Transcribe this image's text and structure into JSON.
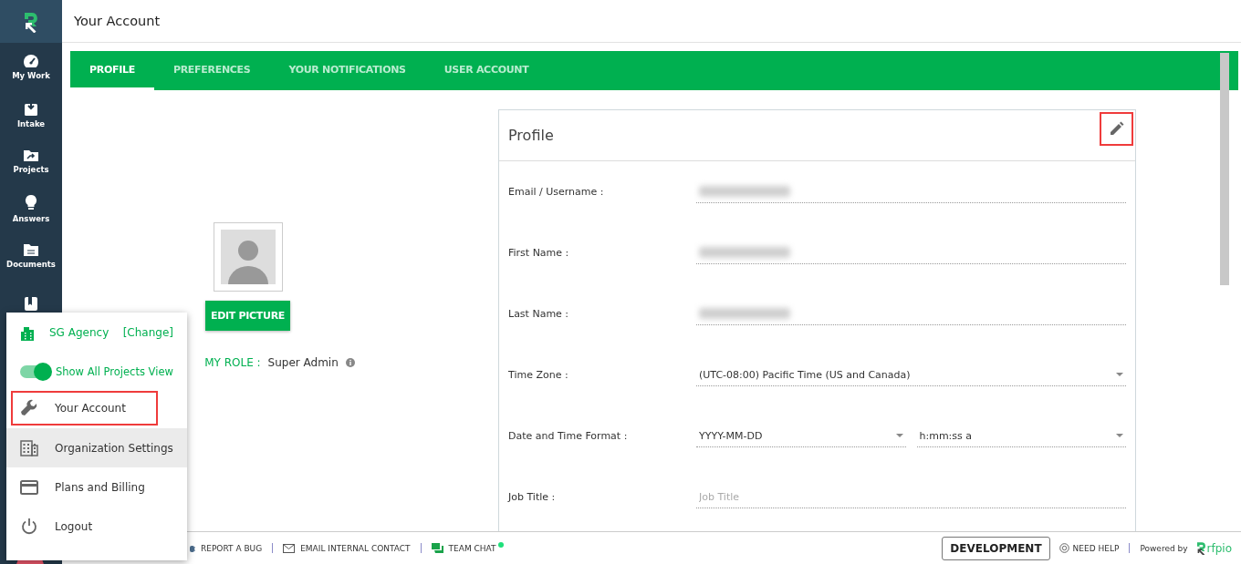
{
  "sidebar": {
    "items": [
      {
        "kind": "gauge",
        "label": "My Work"
      },
      {
        "kind": "inbox",
        "label": "Intake"
      },
      {
        "kind": "folder",
        "label": "Projects"
      },
      {
        "kind": "bulb",
        "label": "Answers"
      },
      {
        "kind": "docs",
        "label": "Documents"
      },
      {
        "kind": "book"
      }
    ]
  },
  "header": {
    "title": "Your Account"
  },
  "tabs": [
    {
      "label": "PROFILE",
      "selected": true
    },
    {
      "label": "PREFERENCES",
      "selected": false
    },
    {
      "label": "YOUR NOTIFICATIONS",
      "selected": false
    },
    {
      "label": "USER ACCOUNT",
      "selected": false
    }
  ],
  "avatar": {
    "button": "EDIT PICTURE",
    "role_label": "MY ROLE :",
    "role": "Super Admin"
  },
  "profile": {
    "title": "Profile",
    "edit_outlined": true,
    "fields": [
      {
        "label": "Email / Username :",
        "kind": "blurred"
      },
      {
        "label": "First Name :",
        "kind": "blurred"
      },
      {
        "label": "Last Name :",
        "kind": "blurred"
      },
      {
        "label": "Time Zone :",
        "kind": "select",
        "values": [
          "(UTC-08:00) Pacific Time (US and Canada)"
        ]
      },
      {
        "label": "Date and Time Format :",
        "kind": "select",
        "values": [
          "YYYY-MM-DD",
          "h:mm:ss a"
        ]
      },
      {
        "label": "Job Title :",
        "kind": "text",
        "placeholder": "Job Title"
      }
    ]
  },
  "menu": {
    "agency": "SG Agency",
    "change": "[Change]",
    "toggle": {
      "label": "Show All Projects View",
      "on": true
    },
    "items": [
      {
        "kind": "wrench",
        "label": "Your Account",
        "outlined": true,
        "hovered": false
      },
      {
        "kind": "building",
        "label": "Organization Settings",
        "outlined": false,
        "hovered": true
      },
      {
        "kind": "card",
        "label": "Plans and Billing",
        "outlined": false,
        "hovered": false
      },
      {
        "kind": "power",
        "label": "Logout",
        "outlined": false,
        "hovered": false
      }
    ]
  },
  "footer": {
    "links": [
      {
        "kind": "bug",
        "label": "REPORT A BUG"
      },
      {
        "kind": "mail",
        "label": "EMAIL INTERNAL CONTACT"
      },
      {
        "kind": "chat",
        "label": "TEAM CHAT",
        "online": true
      }
    ],
    "environment": "DEVELOPMENT",
    "help": "NEED HELP",
    "powered": "Powered by",
    "brand": "rfpio"
  }
}
